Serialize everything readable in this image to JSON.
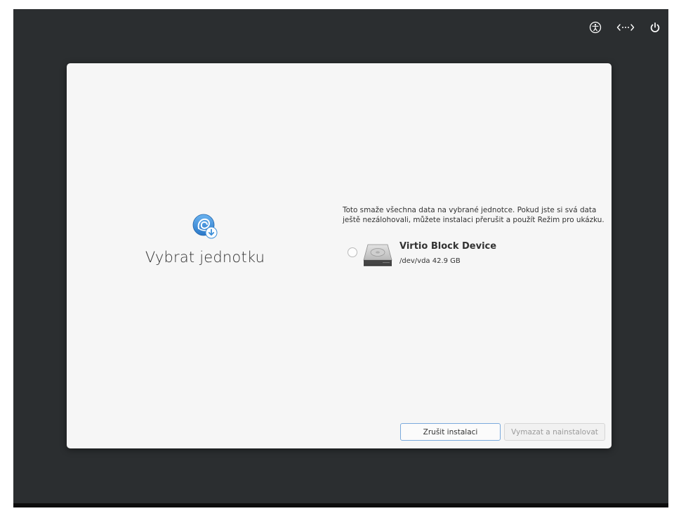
{
  "topbar": {
    "icons": [
      "accessibility-icon",
      "keyboard-layout-icon",
      "power-icon"
    ]
  },
  "dialog": {
    "title": "Vybrat jednotku",
    "warning": "Toto smaže všechna data na vybrané jednotce. Pokud jste si svá data ještě nezálohovali, můžete instalaci přerušit a použít Režim pro ukázku.",
    "drives": [
      {
        "name": "Virtio Block Device",
        "details": "/dev/vda 42.9 GB",
        "selected": false,
        "icon": "hard-drive-icon"
      }
    ],
    "buttons": {
      "cancel_label": "Zrušit instalaci",
      "erase_label": "Vymazat a nainstalovat"
    }
  },
  "colors": {
    "desktop_background": "#2b2e30",
    "dialog_background": "#f6f6f6",
    "accent_border": "#7aa9dc",
    "logo_blue": "#3d8fd8"
  }
}
